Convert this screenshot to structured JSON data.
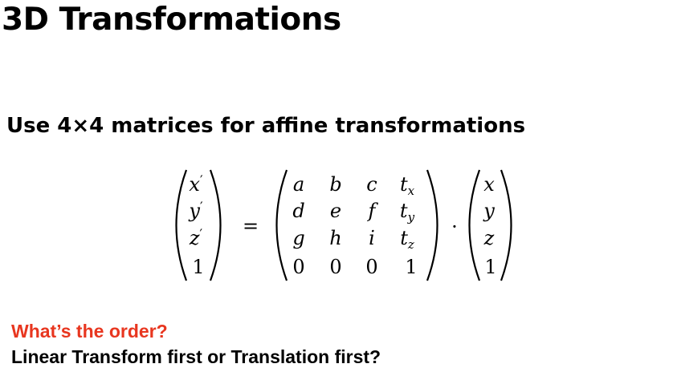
{
  "slide": {
    "title": "3D Transformations",
    "subtitle": "Use 4×4 matrices for affine transformations",
    "question": "What’s the order?",
    "followup": "Linear Transform first or Translation first?",
    "question_color": "#e8361f"
  },
  "equation": {
    "lhs_vector": [
      {
        "base": "x",
        "mark": "′"
      },
      {
        "base": "y",
        "mark": "′"
      },
      {
        "base": "z",
        "mark": "′"
      },
      {
        "base": "1",
        "mark": ""
      }
    ],
    "equals": "=",
    "matrix": [
      [
        "a",
        "b",
        "c",
        {
          "base": "t",
          "sub": "x"
        }
      ],
      [
        "d",
        "e",
        "f",
        {
          "base": "t",
          "sub": "y"
        }
      ],
      [
        "g",
        "h",
        "i",
        {
          "base": "t",
          "sub": "z"
        }
      ],
      [
        "0",
        "0",
        "0",
        "1"
      ]
    ],
    "dot": "·",
    "rhs_vector": [
      "x",
      "y",
      "z",
      "1"
    ]
  }
}
